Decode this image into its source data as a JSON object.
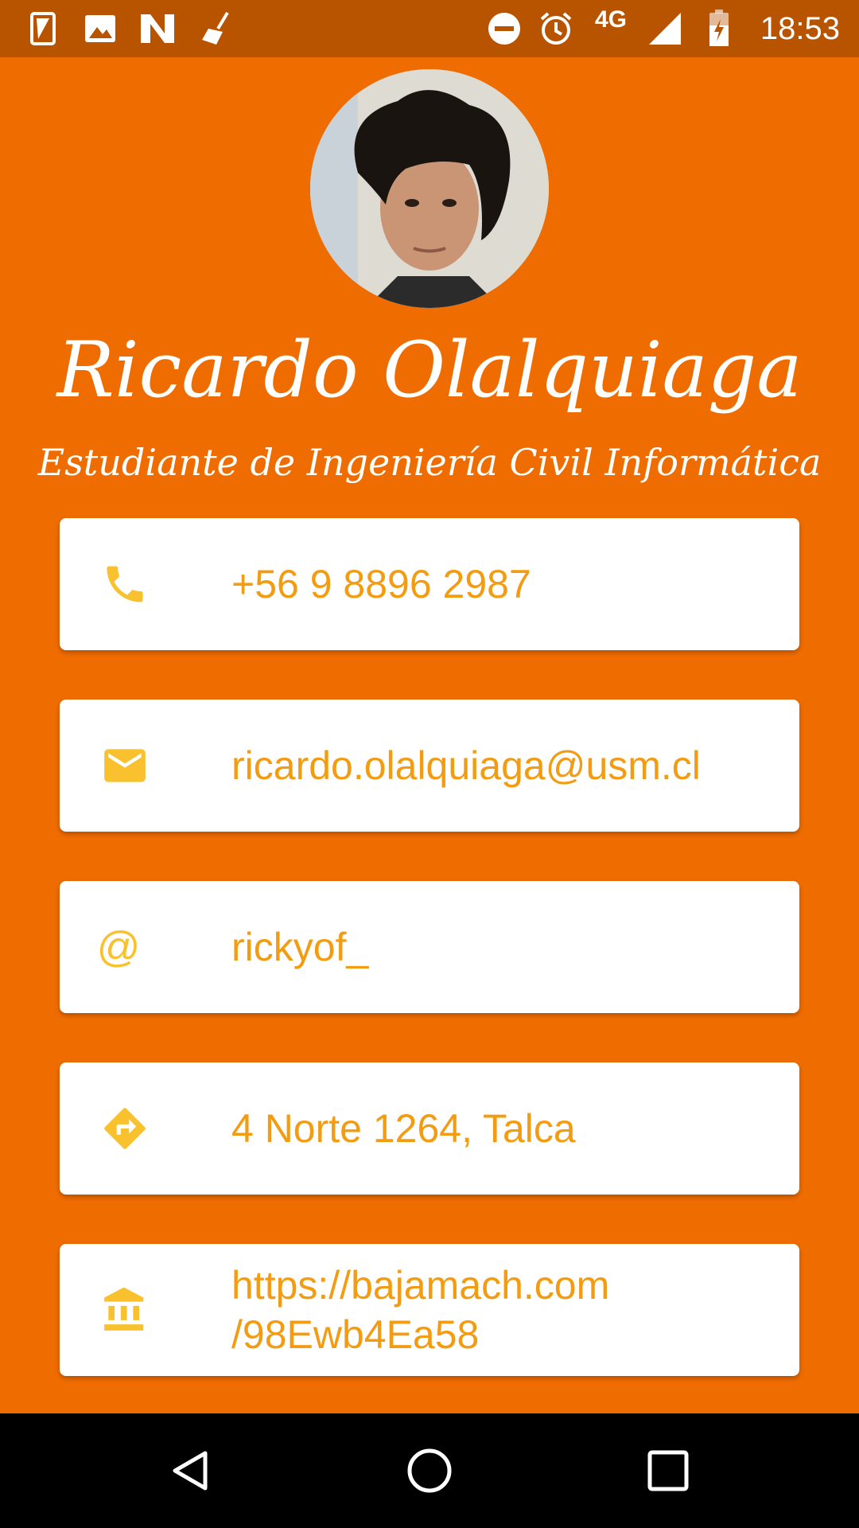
{
  "status_bar": {
    "time": "18:53",
    "network": "4G",
    "left_icons": [
      "sim-card-icon",
      "image-icon",
      "n-icon",
      "broom-icon"
    ],
    "right_icons": [
      "do-not-disturb-icon",
      "alarm-icon",
      "signal-icon",
      "battery-charging-icon"
    ]
  },
  "profile": {
    "name": "Ricardo Olalquiaga",
    "subtitle": "Estudiante de Ingeniería Civil Informática"
  },
  "contacts": [
    {
      "icon": "phone-icon",
      "value": "+56 9 8896 2987"
    },
    {
      "icon": "mail-icon",
      "value": "ricardo.olalquiaga@usm.cl"
    },
    {
      "icon": "at-icon",
      "value": "rickyof_"
    },
    {
      "icon": "directions-icon",
      "value": "4 Norte 1264, Talca"
    },
    {
      "icon": "bank-icon",
      "value": "https://bajamach.com\n/98Ewb4Ea58"
    }
  ],
  "colors": {
    "background": "#ef6c00",
    "status_bar": "#b85400",
    "card": "#ffffff",
    "icon": "#f9c12e",
    "text": "#f39c12"
  },
  "nav_bar": {
    "buttons": [
      "back-icon",
      "home-icon",
      "recents-icon"
    ]
  }
}
